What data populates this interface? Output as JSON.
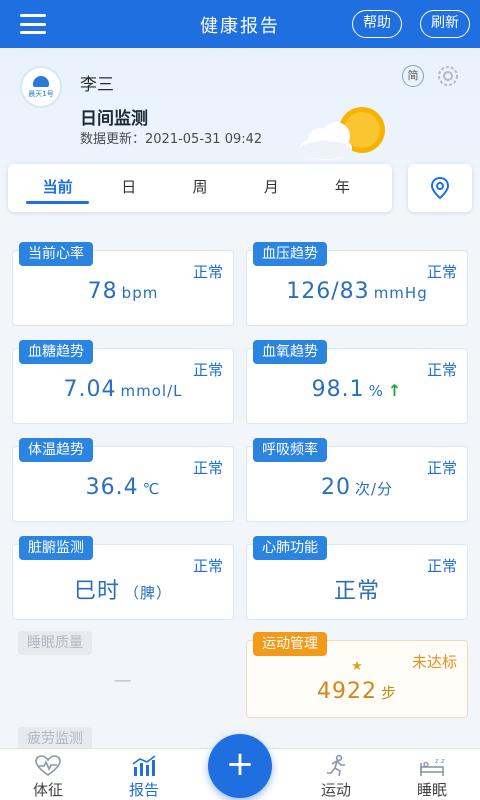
{
  "app": {
    "title": "健康报告",
    "help_label": "帮助",
    "refresh_label": "刷新"
  },
  "profile": {
    "logo_text": "晨天1号",
    "name": "李三",
    "mode_title": "日间监测",
    "update_label": "数据更新：",
    "update_time": "2021-05-31 09:42",
    "simplified_toggle": "简"
  },
  "tabs": [
    {
      "label": "当前",
      "active": true
    },
    {
      "label": "日",
      "active": false
    },
    {
      "label": "周",
      "active": false
    },
    {
      "label": "月",
      "active": false
    },
    {
      "label": "年",
      "active": false
    }
  ],
  "cards": {
    "heart": {
      "title": "当前心率",
      "status": "正常",
      "value": "78",
      "unit": "bpm"
    },
    "bp": {
      "title": "血压趋势",
      "status": "正常",
      "value": "126/83",
      "unit": "mmHg"
    },
    "sugar": {
      "title": "血糖趋势",
      "status": "正常",
      "value": "7.04",
      "unit": "mmol/L"
    },
    "spo2": {
      "title": "血氧趋势",
      "status": "正常",
      "value": "98.1",
      "unit": "%",
      "trend": "↑"
    },
    "temp": {
      "title": "体温趋势",
      "status": "正常",
      "value": "36.4",
      "unit": "℃"
    },
    "resp": {
      "title": "呼吸频率",
      "status": "正常",
      "value": "20",
      "unit": "次/分"
    },
    "organ": {
      "title": "脏腑监测",
      "status": "正常",
      "value": "巳时",
      "unit": "（脾）"
    },
    "cardio": {
      "title": "心肺功能",
      "status": "正常",
      "value": "正常"
    },
    "sleep": {
      "title": "睡眠质量",
      "value": "—"
    },
    "sport": {
      "title": "运动管理",
      "status": "未达标",
      "value": "4922",
      "unit": "步",
      "star": "★"
    },
    "fatigue": {
      "title": "疲劳监测"
    }
  },
  "tabbar": {
    "items": [
      {
        "label": "体征",
        "icon": "heart-pulse-icon"
      },
      {
        "label": "报告",
        "icon": "bar-chart-icon",
        "active": true
      },
      {
        "label": "运动",
        "icon": "running-icon"
      },
      {
        "label": "睡眠",
        "icon": "bed-icon"
      }
    ],
    "fab_symbol": "+"
  },
  "colors": {
    "primary": "#1f6fe0",
    "tag_blue": "#2b84e0",
    "sport_orange": "#f29b1b",
    "trend_green": "#1ca84a",
    "sun": "#f6b400"
  }
}
